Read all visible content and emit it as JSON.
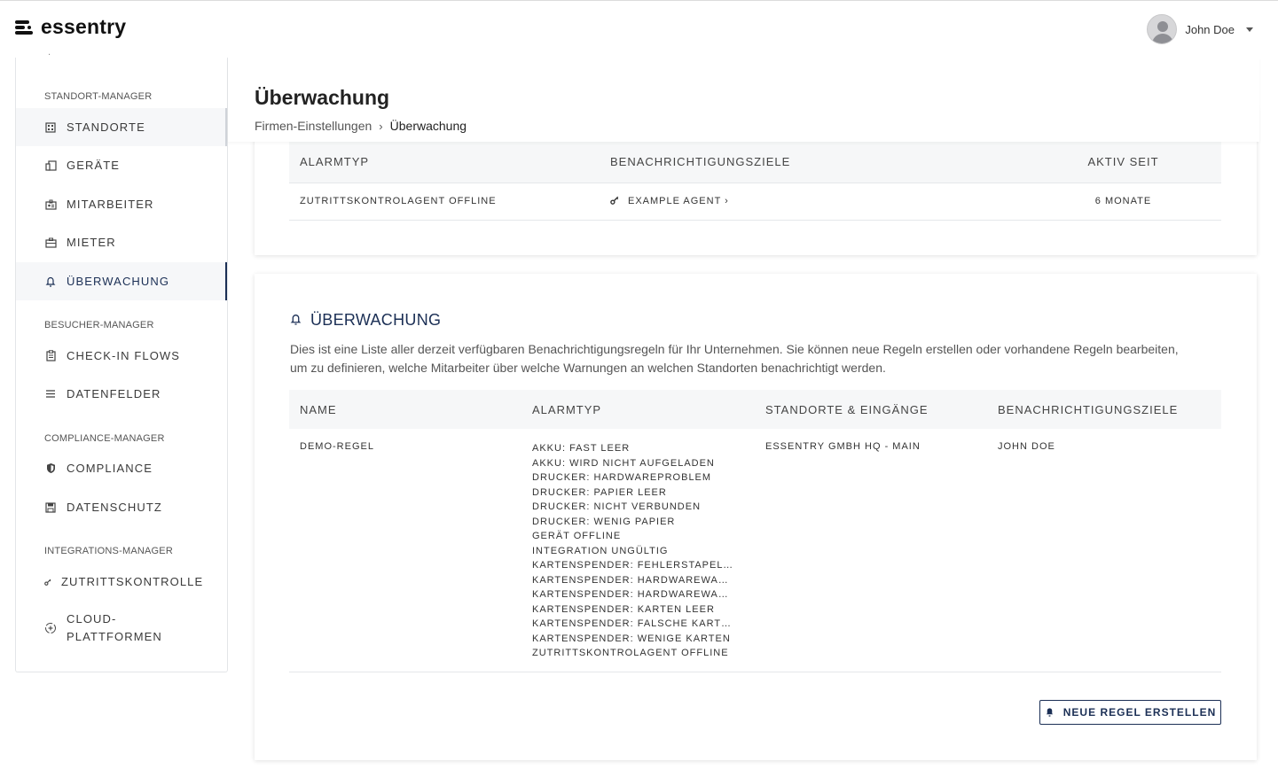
{
  "app": {
    "logo_text": "essentry"
  },
  "user": {
    "name": "John Doe"
  },
  "sidebar": {
    "sections": [
      {
        "title": "STANDORT-MANAGER",
        "items": [
          {
            "label": "STANDORTE",
            "icon": "building-icon"
          },
          {
            "label": "GERÄTE",
            "icon": "devices-icon"
          },
          {
            "label": "MITARBEITER",
            "icon": "badge-icon"
          },
          {
            "label": "MIETER",
            "icon": "briefcase-icon"
          },
          {
            "label": "ÜBERWACHUNG",
            "icon": "bell-icon",
            "active": true
          }
        ]
      },
      {
        "title": "BESUCHER-MANAGER",
        "items": [
          {
            "label": "CHECK-IN FLOWS",
            "icon": "clipboard-icon"
          },
          {
            "label": "DATENFELDER",
            "icon": "list-icon"
          }
        ]
      },
      {
        "title": "COMPLIANCE-MANAGER",
        "items": [
          {
            "label": "COMPLIANCE",
            "icon": "shield-icon"
          },
          {
            "label": "DATENSCHUTZ",
            "icon": "save-icon"
          }
        ]
      },
      {
        "title": "INTEGRATIONS-MANAGER",
        "items": [
          {
            "label": "ZUTRITTSKONTROLLE",
            "icon": "key-icon"
          },
          {
            "label": "CLOUD-\nPLATTFORMEN",
            "icon": "cloud-plus-icon"
          }
        ]
      }
    ]
  },
  "page": {
    "title": "Überwachung",
    "breadcrumb": [
      "Firmen-Einstellungen",
      "Überwachung"
    ]
  },
  "alarms_table": {
    "columns": [
      "ALARMTYP",
      "BENACHRICHTIGUNGSZIELE",
      "AKTIV SEIT"
    ],
    "rows": [
      {
        "alarm": "ZUTRITTSKONTROLAGENT OFFLINE",
        "target": "EXAMPLE AGENT ›",
        "since": "6 MONATE"
      }
    ]
  },
  "rules_card": {
    "title": "ÜBERWACHUNG",
    "description": "Dies ist eine Liste aller derzeit verfügbaren Benachrichtigungsregeln für Ihr Unternehmen. Sie können neue Regeln erstellen oder vorhandene Regeln bearbeiten, um zu definieren, welche Mitarbeiter über welche Warnungen an welchen Standorten benachrichtigt werden.",
    "columns": [
      "NAME",
      "ALARMTYP",
      "STANDORTE & EINGÄNGE",
      "BENACHRICHTIGUNGSZIELE"
    ],
    "rows": [
      {
        "name": "DEMO-REGEL",
        "alarm_types": [
          "AKKU: FAST LEER",
          "AKKU: WIRD NICHT AUFGELADEN",
          "DRUCKER: HARDWAREPROBLEM",
          "DRUCKER: PAPIER LEER",
          "DRUCKER: NICHT VERBUNDEN",
          "DRUCKER: WENIG PAPIER",
          "GERÄT OFFLINE",
          "INTEGRATION UNGÜLTIG",
          "KARTENSPENDER: FEHLERSTAPEL V...",
          "KARTENSPENDER: HARDWAREWART...",
          "KARTENSPENDER: HARDWAREWART...",
          "KARTENSPENDER: KARTEN LEER",
          "KARTENSPENDER: FALSCHE KARTEN...",
          "KARTENSPENDER: WENIGE KARTEN",
          "ZUTRITTSKONTROLAGENT OFFLINE"
        ],
        "locations": "ESSENTRY GMBH HQ - MAIN",
        "targets": "JOHN DOE"
      }
    ],
    "button_label": "NEUE REGEL ERSTELLEN"
  }
}
